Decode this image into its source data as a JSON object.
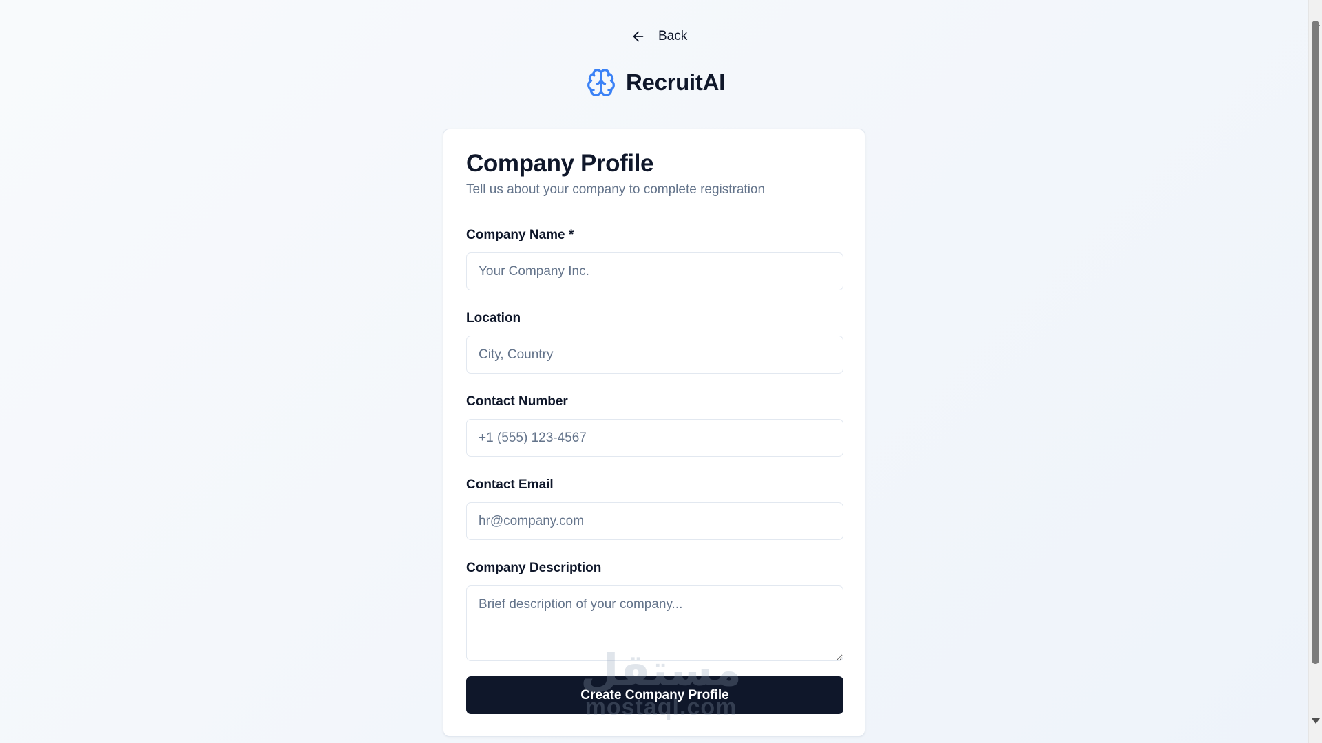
{
  "nav": {
    "back_label": "Back"
  },
  "brand": {
    "name": "RecruitAI",
    "accent": "#3b82f6"
  },
  "card": {
    "title": "Company Profile",
    "subtitle": "Tell us about your company to complete registration"
  },
  "fields": {
    "company_name": {
      "label": "Company Name *",
      "placeholder": "Your Company Inc.",
      "value": ""
    },
    "location": {
      "label": "Location",
      "placeholder": "City, Country",
      "value": ""
    },
    "contact_number": {
      "label": "Contact Number",
      "placeholder": "+1 (555) 123-4567",
      "value": ""
    },
    "contact_email": {
      "label": "Contact Email",
      "placeholder": "hr@company.com",
      "value": ""
    },
    "description": {
      "label": "Company Description",
      "placeholder": "Brief description of your company...",
      "value": ""
    }
  },
  "submit_label": "Create Company Profile",
  "watermark": {
    "arabic": "مستقل",
    "latin": "mostaql.com"
  },
  "colors": {
    "primary": "#0f172a",
    "muted": "#64748b",
    "border": "#e2e8f0",
    "background": "#f4f7fb"
  }
}
